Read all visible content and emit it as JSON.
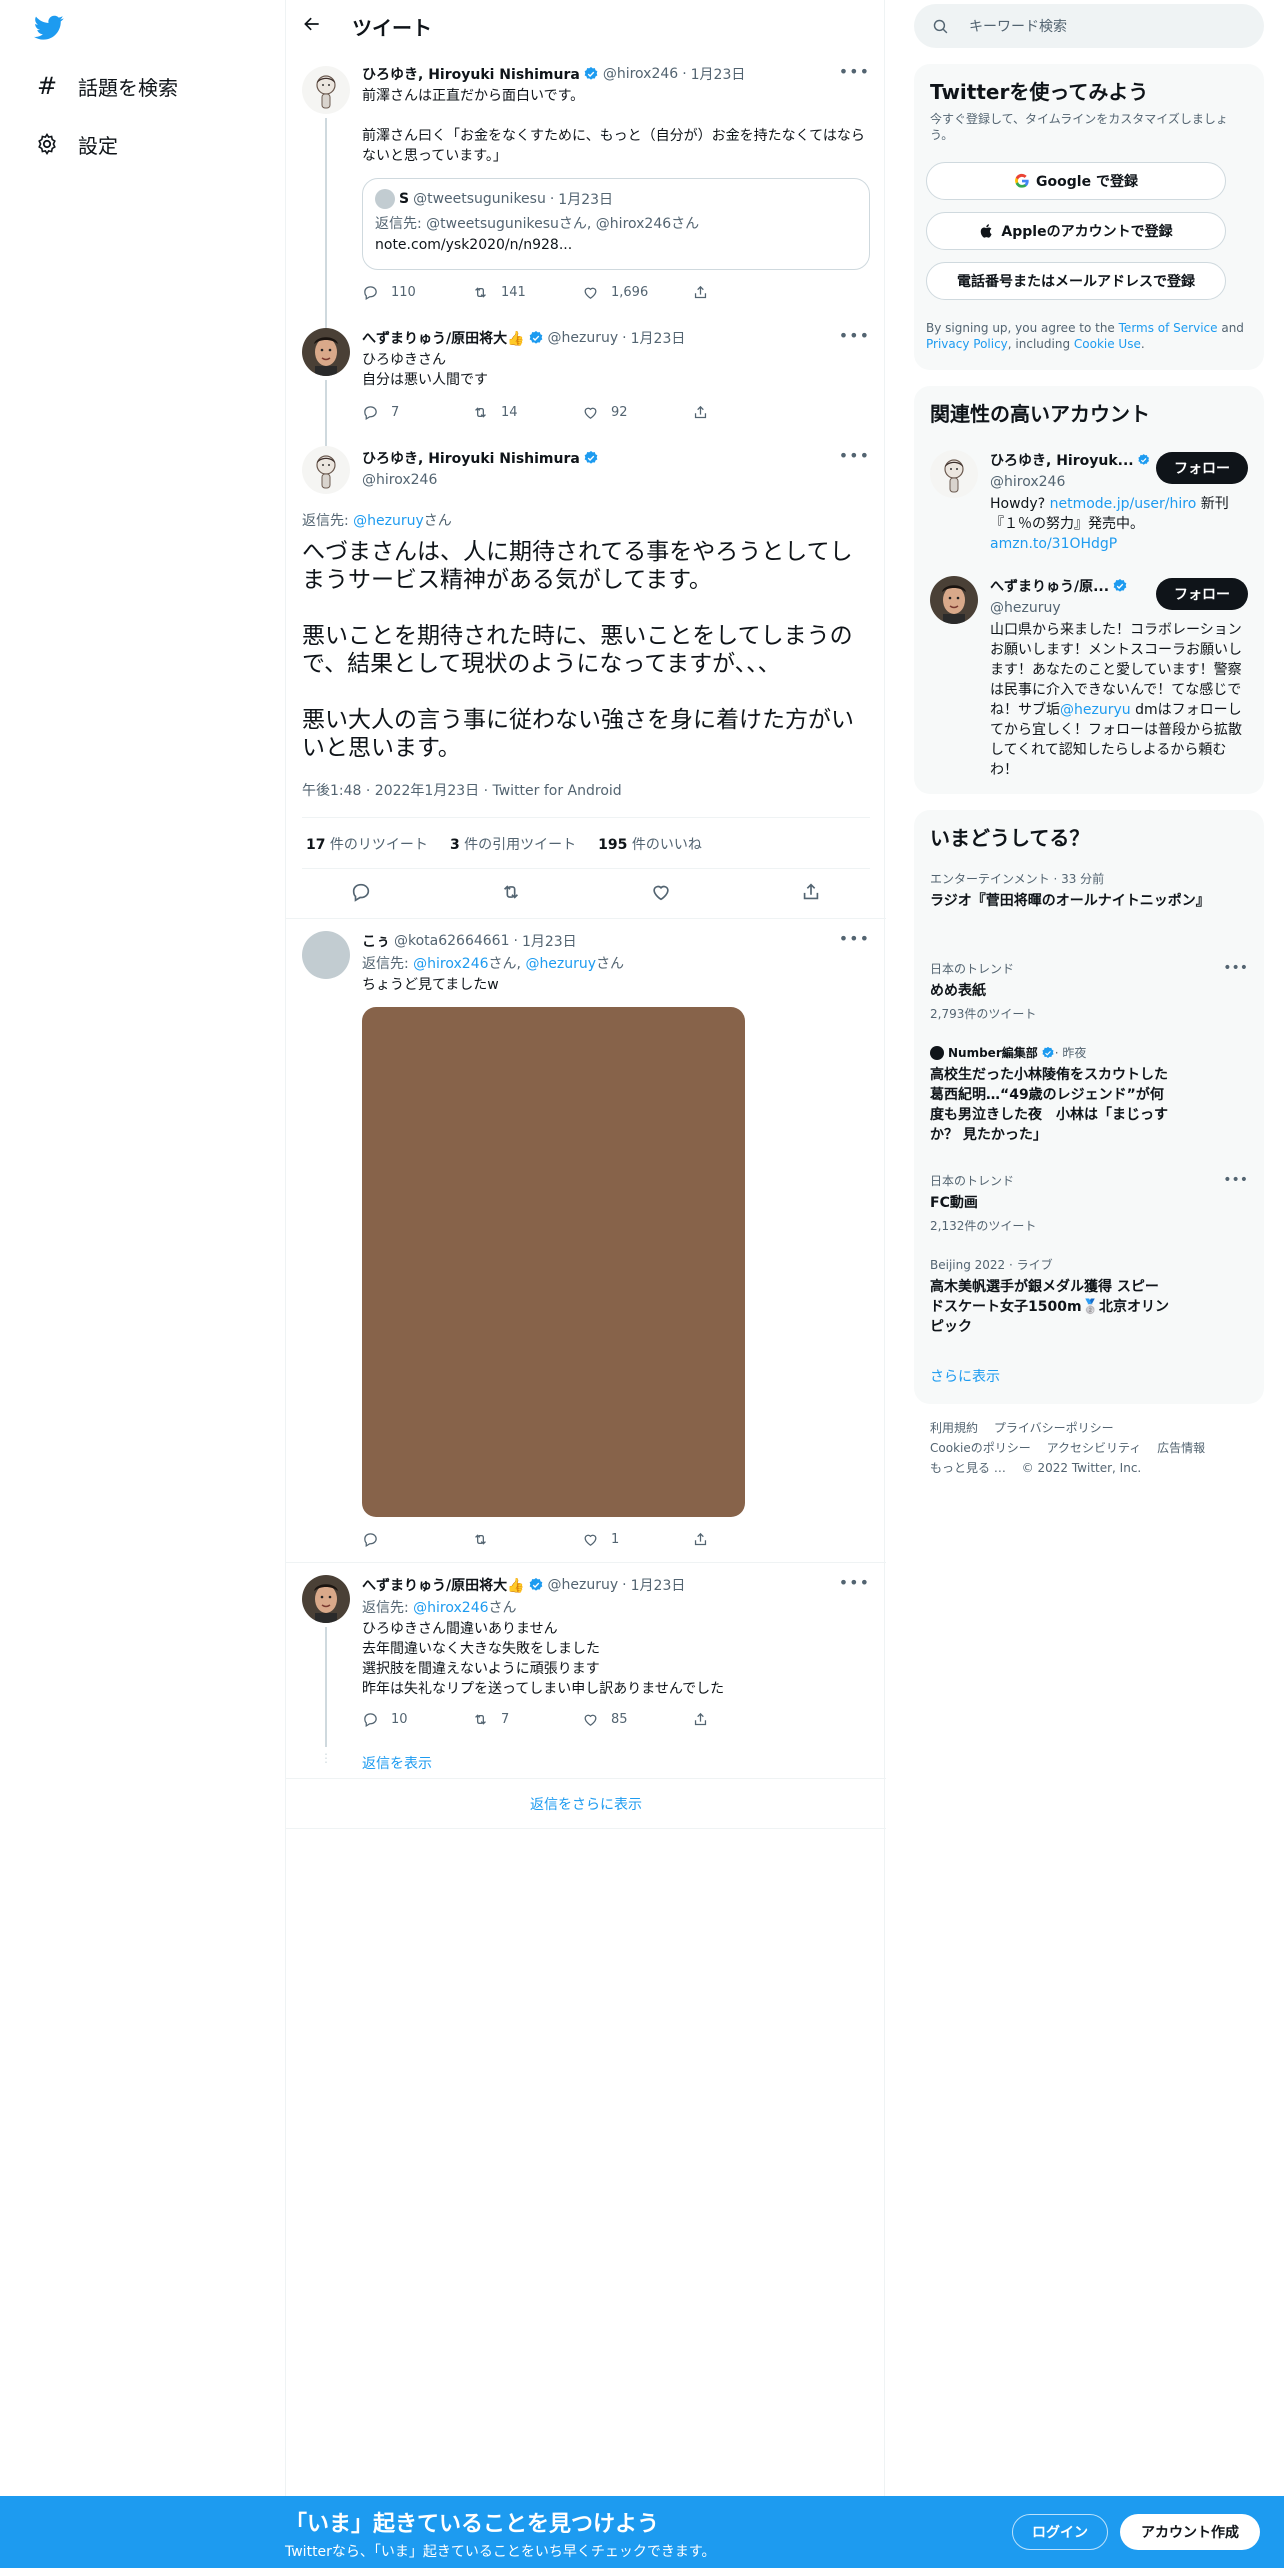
{
  "nav": {
    "explore_label": "話題を検索",
    "settings_label": "設定"
  },
  "header": {
    "title": "ツイート"
  },
  "tweets": [
    {
      "name": "ひろゆき, Hiroyuki Nishimura",
      "handle": "@hirox246",
      "date": "1月23日",
      "text": "前澤さんは正直だから面白いです。\n\n前澤さん曰く「お金をなくすために、もっと（自分が）お金を持たなくてはならないと思っています。」",
      "quote": {
        "name": "S",
        "handle": "@tweetsugunikesu",
        "date": "1月23日",
        "reply_prefix": "返信先: ",
        "reply_to": "@tweetsugunikesuさん, @hirox246さん",
        "link": "note.com/ysk2020/n/n928..."
      },
      "replies": "110",
      "retweets": "141",
      "likes": "1,696"
    },
    {
      "name": "へずまりゅう/原田将大👍",
      "handle": "@hezuruy",
      "date": "1月23日",
      "text": "ひろゆきさん\n自分は悪い人間です",
      "replies": "7",
      "retweets": "14",
      "likes": "92"
    }
  ],
  "focused": {
    "name": "ひろゆき, Hiroyuki Nishimura",
    "handle": "@hirox246",
    "reply_prefix": "返信先: ",
    "reply_handle": "@hezuruy",
    "reply_suffix": "さん",
    "text": "へづまさんは、人に期待されてる事をやろうとしてしまうサービス精神がある気がしてます。\n\n悪いことを期待された時に、悪いことをしてしまうので、結果として現状のようになってますが、、、\n\n悪い大人の言う事に従わない強さを身に着けた方がいいと思います。",
    "meta": "午後1:48 · 2022年1月23日 · Twitter for Android",
    "retweets_count": "17",
    "retweets_label": " 件のリツイート",
    "quotes_count": "3",
    "quotes_label": " 件の引用ツイート",
    "likes_count": "195",
    "likes_label": " 件のいいね"
  },
  "replies": [
    {
      "name": "こぅ",
      "handle": "@kota62664661",
      "date": "1月23日",
      "reply_prefix": "返信先: ",
      "reply_to_1": "@hirox246",
      "reply_sep": "さん, ",
      "reply_to_2": "@hezuruy",
      "reply_suffix": "さん",
      "text": "ちょうど見てましたw",
      "likes": "1"
    },
    {
      "name": "へずまりゅう/原田将大👍",
      "handle": "@hezuruy",
      "date": "1月23日",
      "reply_prefix": "返信先: ",
      "reply_to": "@hirox246",
      "reply_suffix": "さん",
      "text": "ひろゆきさん間違いありません\n去年間違いなく大きな失敗をしました\n選択肢を間違えないように頑張ります\n昨年は失礼なリプを送ってしまい申し訳ありませんでした",
      "replies": "10",
      "retweets": "7",
      "likes": "85"
    }
  ],
  "show_replies_label": "返信を表示",
  "more_replies_label": "返信をさらに表示",
  "search": {
    "placeholder": "キーワード検索"
  },
  "signup_card": {
    "title": "Twitterを使ってみよう",
    "subtitle": "今すぐ登録して、タイムラインをカスタマイズしましょう。",
    "google": "Google で登録",
    "apple": "Appleのアカウントで登録",
    "phone": "電話番号またはメールアドレスで登録",
    "terms_1": "By signing up, you agree to the ",
    "terms_link_1": "Terms of Service",
    "terms_2": " and ",
    "terms_link_2": "Privacy Policy",
    "terms_3": ", including ",
    "terms_link_3": "Cookie Use",
    "terms_4": "."
  },
  "related": {
    "title": "関連性の高いアカウント",
    "follow_label": "フォロー",
    "accounts": [
      {
        "name": "ひろゆき, Hiroyuk...",
        "handle": "@hirox246",
        "bio_1": "Howdy? ",
        "bio_link_1": "netmode.jp/user/hiro",
        "bio_2": " 新刊『１％の努力』発売中。",
        "bio_link_2": "amzn.to/31OHdgP"
      },
      {
        "name": "へずまりゅう/原...",
        "handle": "@hezuruy",
        "bio_1": "山口県から来ました！コラボレーションお願いします！メントスコーラお願いします！あなたのこと愛しています！警察は民事に介入できないんで！てな感じでね！サブ垢",
        "bio_link_1": "@hezuryu",
        "bio_2": " dmはフォローしてから宜しく！フォローは普段から拡散してくれて認知したらしよるから頼むわ！"
      }
    ]
  },
  "trends": {
    "title": "いまどうしてる？",
    "items": [
      {
        "meta": "エンターテインメント · 33 分前",
        "title": "ラジオ『菅田将暉のオールナイトニッポン』",
        "count": ""
      },
      {
        "meta": "日本のトレンド",
        "title": "めめ表紙",
        "count": "2,793件のツイート"
      },
      {
        "meta_source": "Number編集部",
        "meta_time": " · 昨夜",
        "title": "高校生だった小林陵侑をスカウトした葛西紀明…“49歳のレジェンド”が何度も男泣きした夜　小林は「まじっすか？ 見たかった」",
        "count": ""
      },
      {
        "meta": "日本のトレンド",
        "title": "FC動画",
        "count": "2,132件のツイート"
      },
      {
        "meta": "Beijing 2022 · ライブ",
        "title": "高木美帆選手が銀メダル獲得 スピードスケート女子1500m🥈北京オリンピック",
        "count": ""
      }
    ],
    "show_more": "さらに表示"
  },
  "footer": {
    "terms": "利用規約",
    "privacy": "プライバシーポリシー",
    "cookie": "Cookieのポリシー",
    "accessibility": "アクセシビリティ",
    "ads": "広告情報",
    "more": "もっと見る …",
    "copyright": "© 2022 Twitter, Inc."
  },
  "bottom_bar": {
    "title": "「いま」起きていることを見つけよう",
    "subtitle": "Twitterなら、「いま」起きていることをいち早くチェックできます。",
    "login": "ログイン",
    "signup": "アカウント作成"
  },
  "colors": {
    "accent": "#1d9bf0",
    "text": "#0f1419",
    "muted": "#536471",
    "media": "#87634a"
  },
  "icons": [
    "twitter-logo-icon",
    "hashtag-icon",
    "gear-icon",
    "back-arrow-icon",
    "verified-icon",
    "reply-icon",
    "retweet-icon",
    "like-icon",
    "share-icon",
    "search-icon",
    "google-icon",
    "apple-icon",
    "more-icon"
  ]
}
